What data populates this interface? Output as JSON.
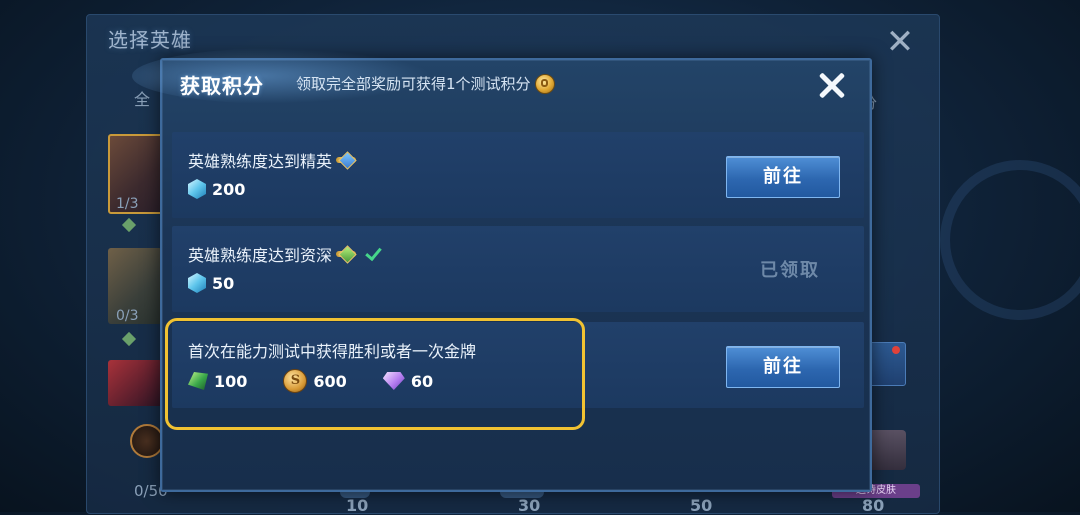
{
  "background": {
    "title": "选择英雄",
    "tab_left": "全",
    "tab_right": "分",
    "hero_counts": [
      "1/3",
      "0/3"
    ],
    "progress_text": "0/50",
    "milestones": [
      "10",
      "30",
      "50",
      "80"
    ],
    "badge_text": "送诗皮肤"
  },
  "modal": {
    "title": "获取积分",
    "subtitle": "领取完全部奖励可获得1个测试积分",
    "tasks": [
      {
        "title": "英雄熟练度达到精英",
        "rewards": [
          {
            "icon": "crystal-icon",
            "value": "200"
          }
        ],
        "action": "前往",
        "status": "available"
      },
      {
        "title": "英雄熟练度达到资深",
        "rewards": [
          {
            "icon": "crystal-icon",
            "value": "50"
          }
        ],
        "action": "已领取",
        "status": "claimed"
      },
      {
        "title": "首次在能力测试中获得胜利或者一次金牌",
        "rewards": [
          {
            "icon": "emerald-icon",
            "value": "100"
          },
          {
            "icon": "gold-coin-icon",
            "value": "600"
          },
          {
            "icon": "diamond-icon",
            "value": "60"
          }
        ],
        "action": "前往",
        "status": "available"
      }
    ]
  },
  "colors": {
    "accent_button": "#2d67b0",
    "highlight": "#f1c232",
    "claimed_text": "#6e89a8"
  }
}
